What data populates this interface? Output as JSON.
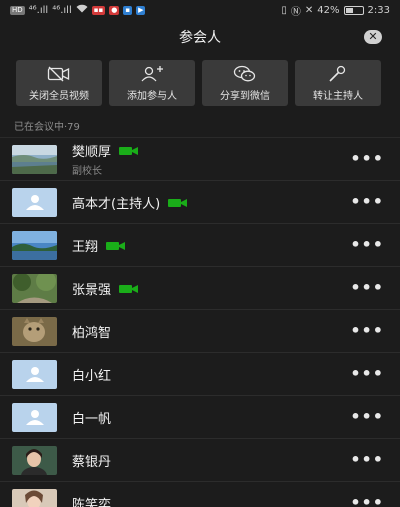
{
  "status_bar": {
    "left_hd": "HD",
    "left_sig1": "⁴⁶.ıll",
    "left_sig2": "⁴⁶.ıll",
    "right_percent": "42%",
    "time": "2:33"
  },
  "header": {
    "title": "参会人",
    "close_symbol": "✕"
  },
  "actions": [
    {
      "label": "关闭全员视频",
      "icon": "camera-off-icon"
    },
    {
      "label": "添加参与人",
      "icon": "add-person-icon"
    },
    {
      "label": "分享到微信",
      "icon": "wechat-icon"
    },
    {
      "label": "转让主持人",
      "icon": "microphone-icon"
    }
  ],
  "count_label": "已在会议中·79",
  "participants": [
    {
      "name": "樊顺厚",
      "subtitle": "副校长",
      "video_on": true,
      "avatar": "photo-lake"
    },
    {
      "name": "高本才(主持人)",
      "subtitle": "",
      "video_on": true,
      "avatar": "default"
    },
    {
      "name": "王翔",
      "subtitle": "",
      "video_on": true,
      "avatar": "photo-sky"
    },
    {
      "name": "张景强",
      "subtitle": "",
      "video_on": true,
      "avatar": "photo-garden"
    },
    {
      "name": "柏鸿智",
      "subtitle": "",
      "video_on": false,
      "avatar": "photo-cat"
    },
    {
      "name": "白小红",
      "subtitle": "",
      "video_on": false,
      "avatar": "default"
    },
    {
      "name": "白一帆",
      "subtitle": "",
      "video_on": false,
      "avatar": "default"
    },
    {
      "name": "蔡银丹",
      "subtitle": "",
      "video_on": false,
      "avatar": "photo-portrait"
    },
    {
      "name": "陈笑奕",
      "subtitle": "",
      "video_on": false,
      "avatar": "photo-portrait2"
    }
  ],
  "more_symbol": "•••",
  "colors": {
    "background": "#1c1c1c",
    "button_bg": "#3a3a3a",
    "video_green": "#1aad19",
    "default_avatar": "#b9d3ec"
  }
}
